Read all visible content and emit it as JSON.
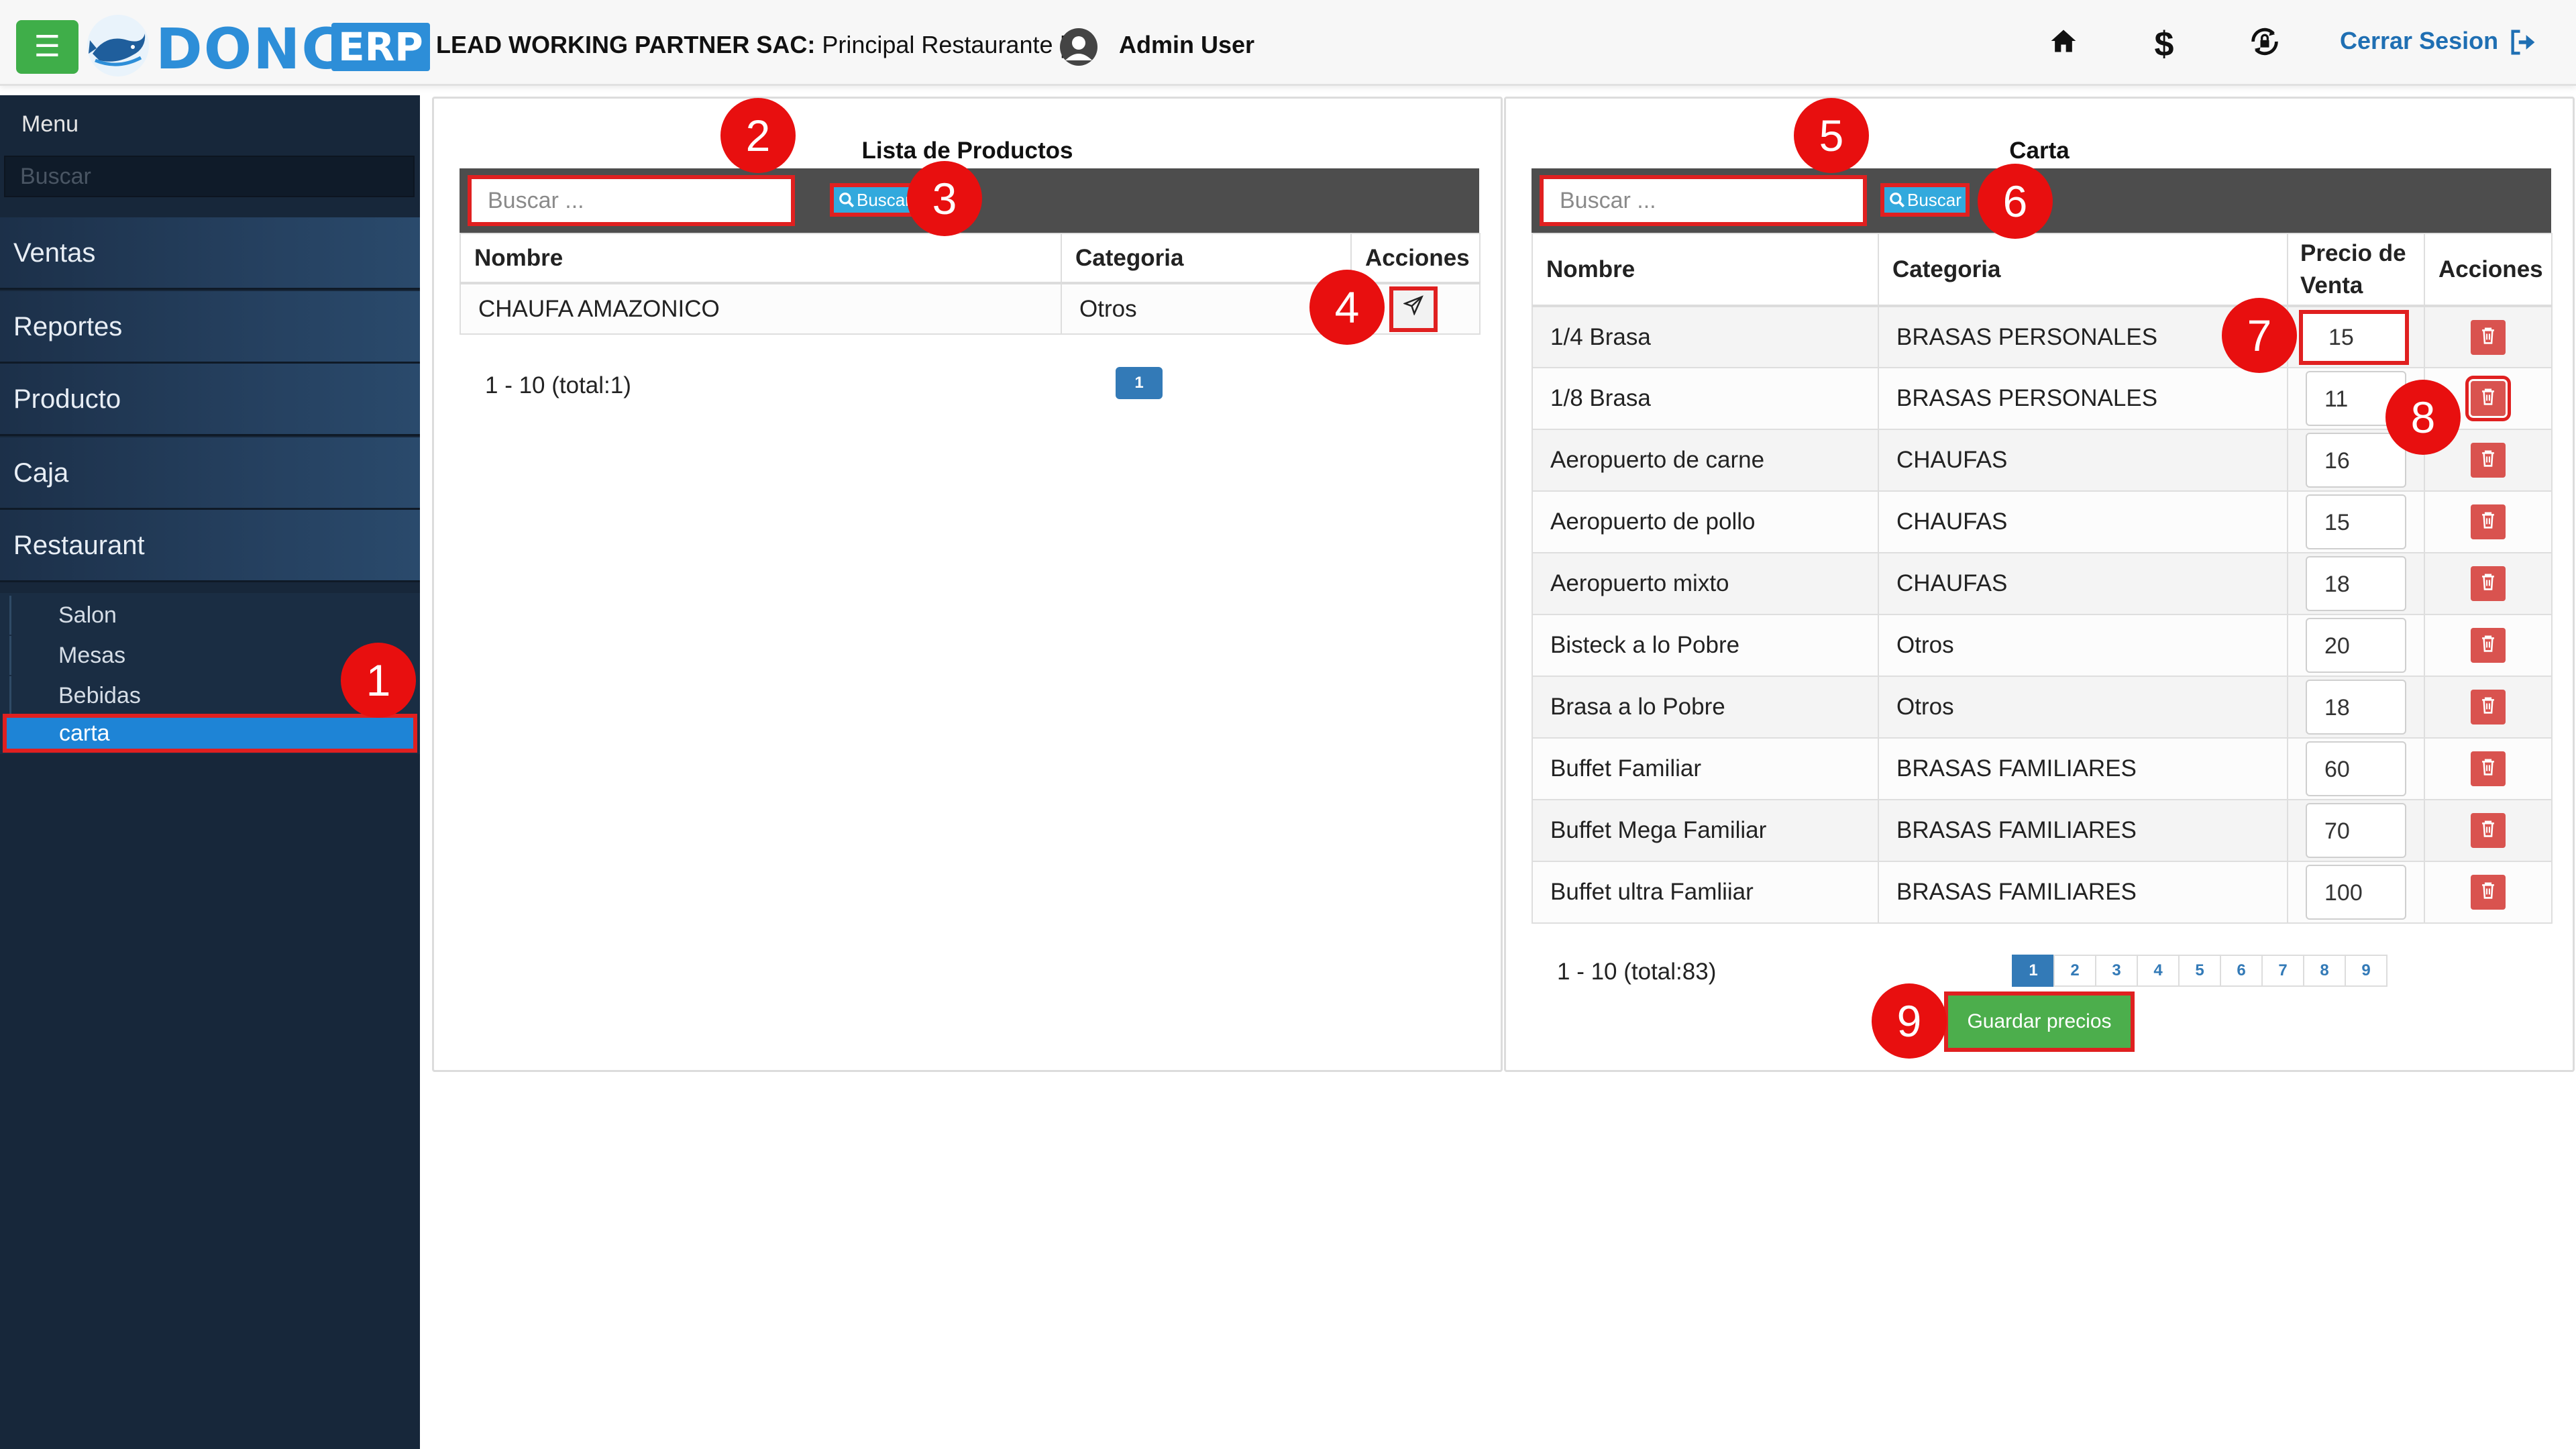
{
  "header": {
    "menu_icon": "hamburger-icon",
    "logo_text": "DONCA",
    "logo_badge": "ERP",
    "company_name": "LEAD WORKING PARTNER SAC:",
    "branch": " Principal Restaurante |",
    "username": "Admin User",
    "icons": [
      "home-icon",
      "dollar-icon",
      "lock-refresh-icon"
    ],
    "logout_label": "Cerrar Sesion",
    "accent": "#2d8ed8"
  },
  "sidebar": {
    "title": "Menu",
    "search_placeholder": "Buscar",
    "items": [
      {
        "label": "Ventas"
      },
      {
        "label": "Reportes"
      },
      {
        "label": "Producto"
      },
      {
        "label": "Caja"
      },
      {
        "label": "Restaurant"
      }
    ],
    "subitems": [
      {
        "label": "Salon"
      },
      {
        "label": "Mesas"
      },
      {
        "label": "Bebidas"
      },
      {
        "label": "carta",
        "active": true
      }
    ]
  },
  "productos": {
    "title": "Lista de Productos",
    "search_placeholder": "Buscar ...",
    "search_button": "Buscar",
    "columns": [
      "Nombre",
      "Categoria",
      "Acciones"
    ],
    "rows": [
      {
        "nombre": "CHAUFA AMAZONICO",
        "categoria": "Otros"
      }
    ],
    "pager_info": "1 - 10 (total:1)",
    "pages": [
      "1"
    ]
  },
  "carta": {
    "title": "Carta",
    "search_placeholder": "Buscar ...",
    "search_button": "Buscar",
    "columns": [
      "Nombre",
      "Categoria",
      "Precio de Venta",
      "Acciones"
    ],
    "rows": [
      {
        "nombre": "1/4 Brasa",
        "categoria": "BRASAS PERSONALES",
        "precio": "15"
      },
      {
        "nombre": "1/8 Brasa",
        "categoria": "BRASAS PERSONALES",
        "precio": "11"
      },
      {
        "nombre": "Aeropuerto de carne",
        "categoria": "CHAUFAS",
        "precio": "16"
      },
      {
        "nombre": "Aeropuerto de pollo",
        "categoria": "CHAUFAS",
        "precio": "15"
      },
      {
        "nombre": "Aeropuerto mixto",
        "categoria": "CHAUFAS",
        "precio": "18"
      },
      {
        "nombre": "Bisteck a lo Pobre",
        "categoria": "Otros",
        "precio": "20"
      },
      {
        "nombre": "Brasa a lo Pobre",
        "categoria": "Otros",
        "precio": "18"
      },
      {
        "nombre": "Buffet Familiar",
        "categoria": "BRASAS FAMILIARES",
        "precio": "60"
      },
      {
        "nombre": "Buffet Mega Familiar",
        "categoria": "BRASAS FAMILIARES",
        "precio": "70"
      },
      {
        "nombre": "Buffet ultra Famliiar",
        "categoria": "BRASAS FAMILIARES",
        "precio": "100"
      }
    ],
    "pager_info": "1 - 10 (total:83)",
    "pages": [
      "1",
      "2",
      "3",
      "4",
      "5",
      "6",
      "7",
      "8",
      "9"
    ],
    "save_button": "Guardar precios"
  },
  "callouts": [
    "1",
    "2",
    "3",
    "4",
    "5",
    "6",
    "7",
    "8",
    "9"
  ],
  "colors": {
    "callout": "#e80f0f",
    "highlight_border": "#e02020",
    "save": "#4cae4c",
    "delete": "#d9534f",
    "search_button": "#32a9dd"
  }
}
